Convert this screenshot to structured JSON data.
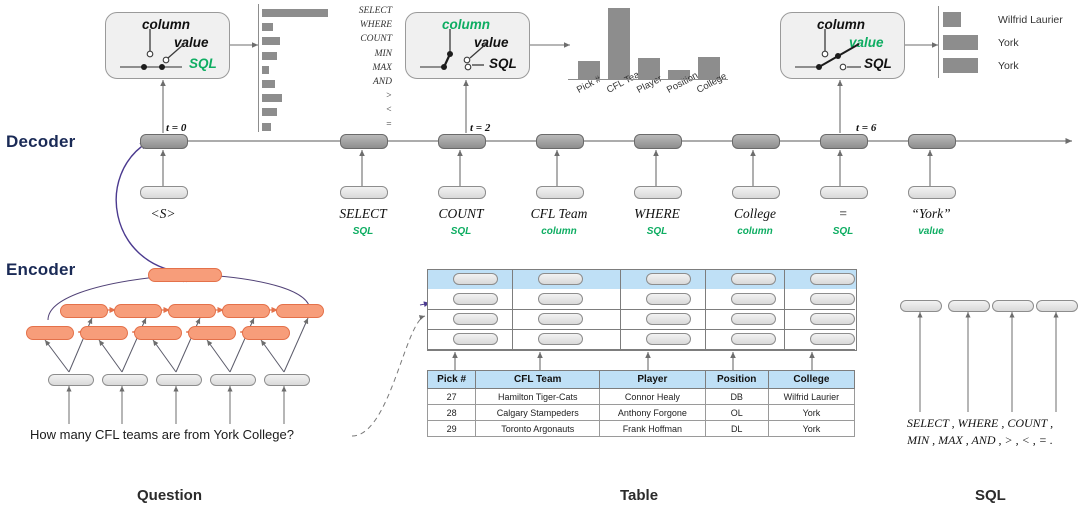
{
  "sections": {
    "decoder_label": "Decoder",
    "encoder_label": "Encoder",
    "bottom": {
      "question": "Question",
      "table": "Table",
      "sql": "SQL"
    }
  },
  "question": {
    "text": "How many CFL teams are from York College?"
  },
  "switch_boxes": [
    {
      "id": "box-t0",
      "time_label": "t = 0",
      "options": [
        "column",
        "value",
        "SQL"
      ],
      "selected": "SQL"
    },
    {
      "id": "box-t2",
      "time_label": "t = 2",
      "options": [
        "column",
        "value",
        "SQL"
      ],
      "selected": "column"
    },
    {
      "id": "box-t6",
      "time_label": "t = 6",
      "options": [
        "column",
        "value",
        "SQL"
      ],
      "selected": "value"
    }
  ],
  "decoder_tokens": [
    {
      "token": "<S>",
      "type": ""
    },
    {
      "token": "SELECT",
      "type": "SQL"
    },
    {
      "token": "COUNT",
      "type": "SQL"
    },
    {
      "token": "CFL Team",
      "type": "column"
    },
    {
      "token": "WHERE",
      "type": "SQL"
    },
    {
      "token": "College",
      "type": "column"
    },
    {
      "token": "=",
      "type": "SQL"
    },
    {
      "token": "“York”",
      "type": "value"
    }
  ],
  "chart_data": [
    {
      "id": "sql-vocab-distribution",
      "type": "bar",
      "orientation": "horizontal",
      "title": "",
      "categories": [
        "SELECT",
        "WHERE",
        "COUNT",
        "MIN",
        "MAX",
        "AND",
        ">",
        "<",
        "="
      ],
      "values": [
        100,
        16,
        27,
        22,
        11,
        20,
        31,
        22,
        13
      ],
      "xlabel": "",
      "ylabel": "",
      "xlim": [
        0,
        100
      ]
    },
    {
      "id": "column-pointer-distribution",
      "type": "bar",
      "orientation": "vertical",
      "title": "",
      "categories": [
        "Pick #",
        "CFL Team",
        "Player",
        "Position",
        "College"
      ],
      "values": [
        27,
        100,
        30,
        14,
        32
      ],
      "xlabel": "",
      "ylabel": "",
      "ylim": [
        0,
        100
      ]
    },
    {
      "id": "value-pointer-distribution",
      "type": "bar",
      "orientation": "horizontal",
      "title": "",
      "categories": [
        "Wilfrid Laurier",
        "York",
        "York"
      ],
      "values": [
        38,
        72,
        72
      ],
      "xlabel": "",
      "ylabel": "",
      "xlim": [
        0,
        100
      ]
    }
  ],
  "table": {
    "columns": [
      "Pick #",
      "CFL Team",
      "Player",
      "Position",
      "College"
    ],
    "rows": [
      [
        "27",
        "Hamilton Tiger-Cats",
        "Connor Healy",
        "DB",
        "Wilfrid Laurier"
      ],
      [
        "28",
        "Calgary Stampeders",
        "Anthony Forgone",
        "OL",
        "York"
      ],
      [
        "29",
        "Toronto Argonauts",
        "Frank Hoffman",
        "DL",
        "York"
      ]
    ]
  },
  "sql_vocabulary": {
    "line1": "SELECT , WHERE , COUNT ,",
    "line2": "MIN , MAX , AND , > , < , = ."
  },
  "colors": {
    "encoder_cell": "#f79d7a",
    "decoder_cell": "#9b9b9b",
    "input_cell": "#e3e3e3",
    "bar": "#8d8d8d",
    "table_header": "#bfe0f6",
    "accent_green": "#0ead62",
    "section_label": "#1a2a56",
    "attention_arrow": "#4b3a8f"
  }
}
